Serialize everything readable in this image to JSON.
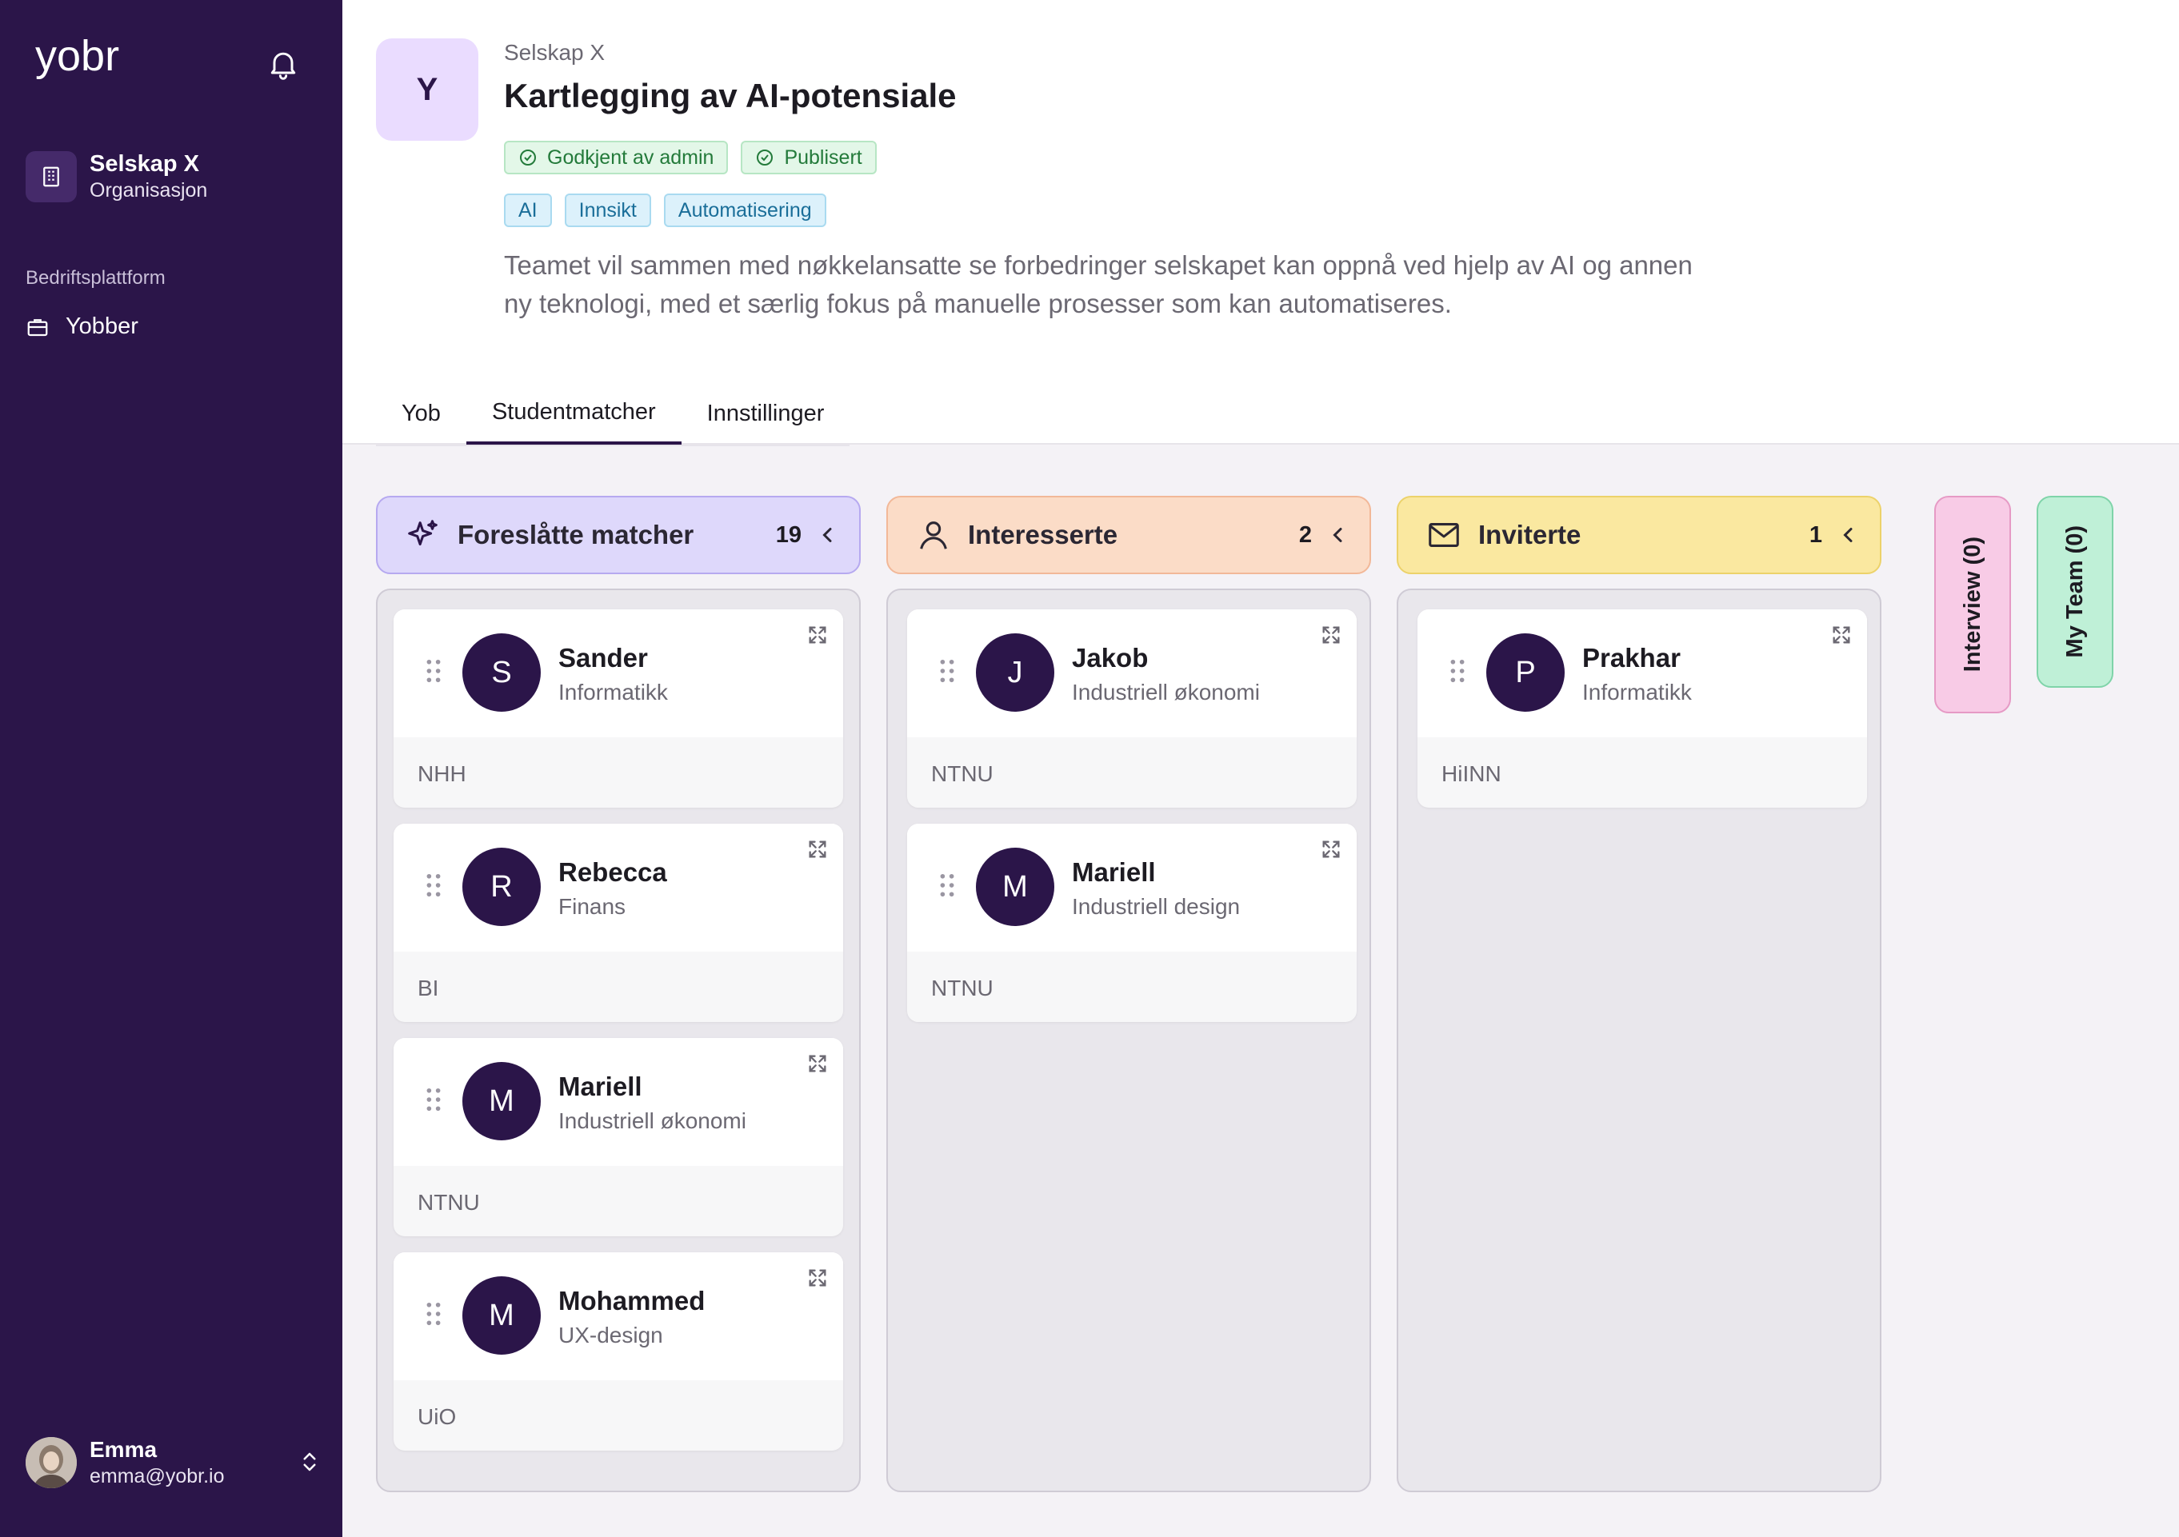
{
  "sidebar": {
    "logo_text": "yobr",
    "org": {
      "name": "Selskap X",
      "type": "Organisasjon"
    },
    "section_label": "Bedriftsplattform",
    "nav": [
      {
        "label": "Yobber",
        "icon": "briefcase-icon"
      }
    ],
    "user": {
      "name": "Emma",
      "email": "emma@yobr.io"
    }
  },
  "project": {
    "badge_letter": "Y",
    "company": "Selskap X",
    "title": "Kartlegging av AI-potensiale",
    "statuses": [
      "Godkjent av admin",
      "Publisert"
    ],
    "tags": [
      "AI",
      "Innsikt",
      "Automatisering"
    ],
    "description": "Teamet vil sammen med nøkkelansatte se forbedringer selskapet kan oppnå ved hjelp av AI og annen ny teknologi, med et særlig fokus på manuelle prosesser som kan automatiseres."
  },
  "tabs": [
    {
      "label": "Yob",
      "active": false
    },
    {
      "label": "Studentmatcher",
      "active": true
    },
    {
      "label": "Innstillinger",
      "active": false
    }
  ],
  "colors": {
    "sidebar_bg": "#2b1549",
    "suggested_bg": "#ded8fb",
    "interested_bg": "#fbdcc7",
    "invited_bg": "#fae8a0",
    "interview_bg": "#f8cbe6",
    "team_bg": "#bff0d7"
  },
  "board": {
    "columns": [
      {
        "title": "Foreslåtte matcher",
        "count": "19",
        "icon": "sparkles-icon",
        "cards": [
          {
            "initial": "S",
            "name": "Sander",
            "field": "Informatikk",
            "school": "NHH"
          },
          {
            "initial": "R",
            "name": "Rebecca",
            "field": "Finans",
            "school": "BI"
          },
          {
            "initial": "M",
            "name": "Mariell",
            "field": "Industriell økonomi",
            "school": "NTNU"
          },
          {
            "initial": "M",
            "name": "Mohammed",
            "field": "UX-design",
            "school": "UiO"
          }
        ]
      },
      {
        "title": "Interesserte",
        "count": "2",
        "icon": "user-icon",
        "cards": [
          {
            "initial": "J",
            "name": "Jakob",
            "field": "Industriell økonomi",
            "school": "NTNU"
          },
          {
            "initial": "M",
            "name": "Mariell",
            "field": "Industriell design",
            "school": "NTNU"
          }
        ]
      },
      {
        "title": "Inviterte",
        "count": "1",
        "icon": "mail-icon",
        "cards": [
          {
            "initial": "P",
            "name": "Prakhar",
            "field": "Informatikk",
            "school": "HiINN"
          }
        ]
      }
    ],
    "collapsed": [
      {
        "label": "Interview  (0)"
      },
      {
        "label": "My Team  (0)"
      }
    ]
  }
}
